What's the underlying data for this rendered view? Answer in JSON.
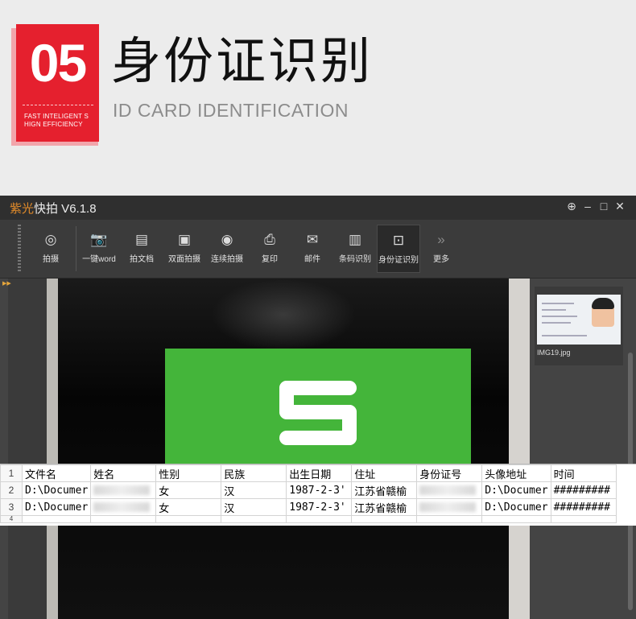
{
  "header": {
    "number": "05",
    "badge_line1": "FAST INTELIGENT S",
    "badge_line2": "HIGN EFFICIENCY",
    "title_zh": "身份证识别",
    "title_en": "ID CARD IDENTIFICATION"
  },
  "app": {
    "brand": "紫光",
    "title": "快拍 V6.1.8",
    "controls": [
      "globe-icon",
      "minimize-icon",
      "maximize-icon",
      "close-icon"
    ],
    "toolbar": [
      {
        "label": "拍摄",
        "icon": "camera-lens-icon"
      },
      {
        "label": "一键word",
        "icon": "camera-icon"
      },
      {
        "label": "拍文档",
        "icon": "document-icon"
      },
      {
        "label": "双面拍摄",
        "icon": "id-card-icon"
      },
      {
        "label": "连续拍摄",
        "icon": "burst-camera-icon"
      },
      {
        "label": "复印",
        "icon": "copy-icon"
      },
      {
        "label": "邮件",
        "icon": "mail-icon"
      },
      {
        "label": "条码识别",
        "icon": "barcode-icon"
      },
      {
        "label": "身份证识别",
        "icon": "id-scan-icon"
      },
      {
        "label": "更多",
        "icon": "more-icon"
      }
    ],
    "active_tool": "身份证识别",
    "thumbnail_name": "IMG19.jpg"
  },
  "sheet": {
    "header_row_num": "1",
    "headers": [
      "文件名",
      "姓名",
      "性别",
      "民族",
      "出生日期",
      "住址",
      "身份证号",
      "头像地址",
      "时间"
    ],
    "rows": [
      {
        "row_num": "2",
        "file": "D:\\Documer",
        "sex": "女",
        "nation": "汉",
        "birth": "1987-2-3'",
        "addr": "江苏省赣榆",
        "avatar": "D:\\Documer",
        "time": "#########"
      },
      {
        "row_num": "3",
        "file": "D:\\Documer",
        "sex": "女",
        "nation": "汉",
        "birth": "1987-2-3'",
        "addr": "江苏省赣榆",
        "avatar": "D:\\Documer",
        "time": "#########"
      }
    ],
    "partial_row_num": "4"
  }
}
